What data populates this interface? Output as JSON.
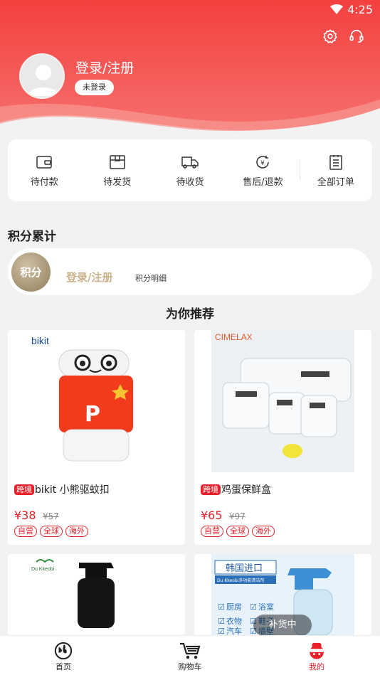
{
  "status": {
    "time": "4:25"
  },
  "profile": {
    "title": "登录/注册",
    "badge": "未登录"
  },
  "orders": [
    {
      "label": "待付款",
      "icon": "wallet-icon"
    },
    {
      "label": "待发货",
      "icon": "box-icon"
    },
    {
      "label": "待收货",
      "icon": "truck-icon"
    },
    {
      "label": "售后/退款",
      "icon": "refund-icon"
    },
    {
      "label": "全部订单",
      "icon": "list-icon"
    }
  ],
  "points": {
    "section_title": "积分累计",
    "medal": "积分",
    "login": "登录/注册",
    "detail": "积分明细"
  },
  "recommend": {
    "title": "为你推荐"
  },
  "products": [
    {
      "tag": "跨境",
      "name": "bikit 小熊驱蚊扣",
      "price": "¥38",
      "orig": "¥57",
      "brand": "bikit",
      "badges": [
        "自营",
        "全球",
        "海外"
      ]
    },
    {
      "tag": "跨境",
      "name": "鸡蛋保鲜盒",
      "price": "¥65",
      "orig": "¥97",
      "brand": "CIMELAX",
      "badges": [
        "自营",
        "全球",
        "海外"
      ]
    },
    {
      "brand": "Du Kkeobi"
    },
    {
      "banner": "韩国进口",
      "subbanner": "Du Kkeobi多功能清洁剂",
      "checks": [
        "厨房",
        "浴室",
        "衣物",
        "鞋子",
        "汽车",
        "墙壁"
      ]
    }
  ],
  "restock": "补货中",
  "tabs": [
    {
      "label": "首页"
    },
    {
      "label": "购物车"
    },
    {
      "label": "我的"
    }
  ],
  "colors": {
    "accent": "#e8202a",
    "header_top": "#f54d4f",
    "header_bottom": "#e8202a",
    "gold": "#c9b28a"
  }
}
